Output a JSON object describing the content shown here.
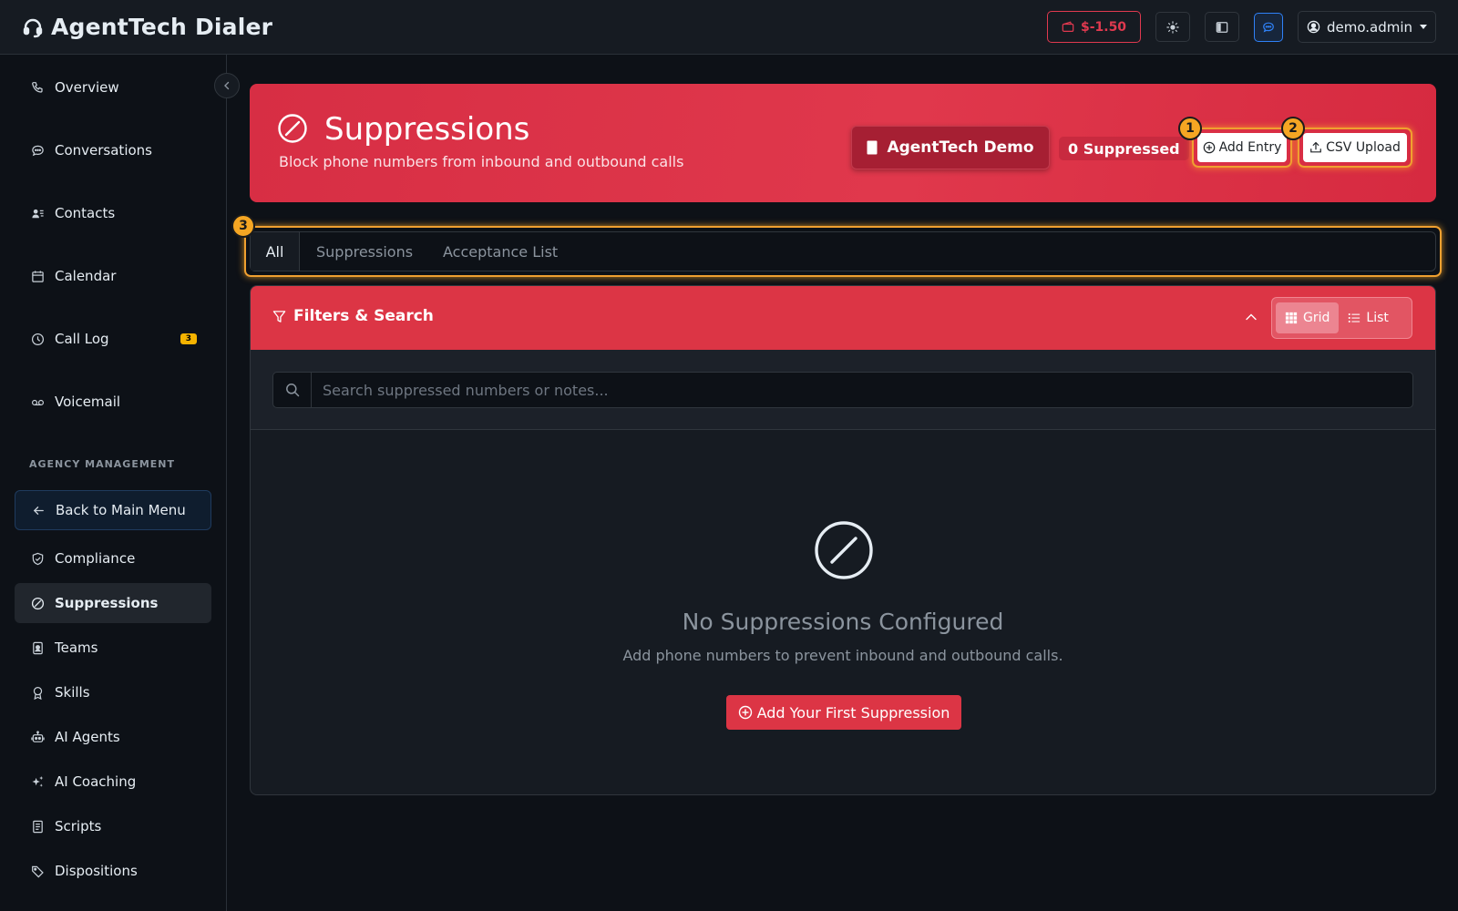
{
  "app": {
    "title": "AgentTech Dialer"
  },
  "topbar": {
    "balance": "$-1.50",
    "user": "demo.admin"
  },
  "sidebar": {
    "items": [
      {
        "label": "Overview",
        "icon": "phone-icon"
      },
      {
        "label": "Conversations",
        "icon": "chat-icon"
      },
      {
        "label": "Contacts",
        "icon": "contacts-icon"
      },
      {
        "label": "Calendar",
        "icon": "calendar-icon"
      },
      {
        "label": "Call Log",
        "icon": "clock-icon",
        "badge": "3"
      },
      {
        "label": "Voicemail",
        "icon": "voicemail-icon"
      }
    ],
    "section_label": "AGENCY MANAGEMENT",
    "back_label": "Back to Main Menu",
    "agency_items": [
      {
        "label": "Compliance",
        "icon": "shield-icon"
      },
      {
        "label": "Suppressions",
        "icon": "ban-icon",
        "active": true
      },
      {
        "label": "Teams",
        "icon": "badge-icon"
      },
      {
        "label": "Skills",
        "icon": "award-icon"
      },
      {
        "label": "AI Agents",
        "icon": "robot-icon"
      },
      {
        "label": "AI Coaching",
        "icon": "sparkle-icon"
      },
      {
        "label": "Scripts",
        "icon": "document-icon"
      },
      {
        "label": "Dispositions",
        "icon": "tag-icon"
      }
    ]
  },
  "hero": {
    "title": "Suppressions",
    "subtitle": "Block phone numbers from inbound and outbound calls",
    "org_name": "AgentTech Demo",
    "count_label": "0 Suppressed",
    "add_entry_label": "Add Entry",
    "csv_upload_label": "CSV Upload"
  },
  "annotations": [
    "1",
    "2",
    "3"
  ],
  "tabs": [
    {
      "label": "All",
      "active": true
    },
    {
      "label": "Suppressions"
    },
    {
      "label": "Acceptance List"
    }
  ],
  "filters": {
    "title": "Filters & Search",
    "view_grid": "Grid",
    "view_list": "List",
    "search_placeholder": "Search suppressed numbers or notes..."
  },
  "empty_state": {
    "title": "No Suppressions Configured",
    "subtitle": "Add phone numbers to prevent inbound and outbound calls.",
    "cta_label": "Add Your First Suppression"
  },
  "colors": {
    "accent_red": "#dc3545",
    "highlight_orange": "#f5a623",
    "badge_yellow": "#f5b300",
    "bg_dark": "#0d1117"
  }
}
